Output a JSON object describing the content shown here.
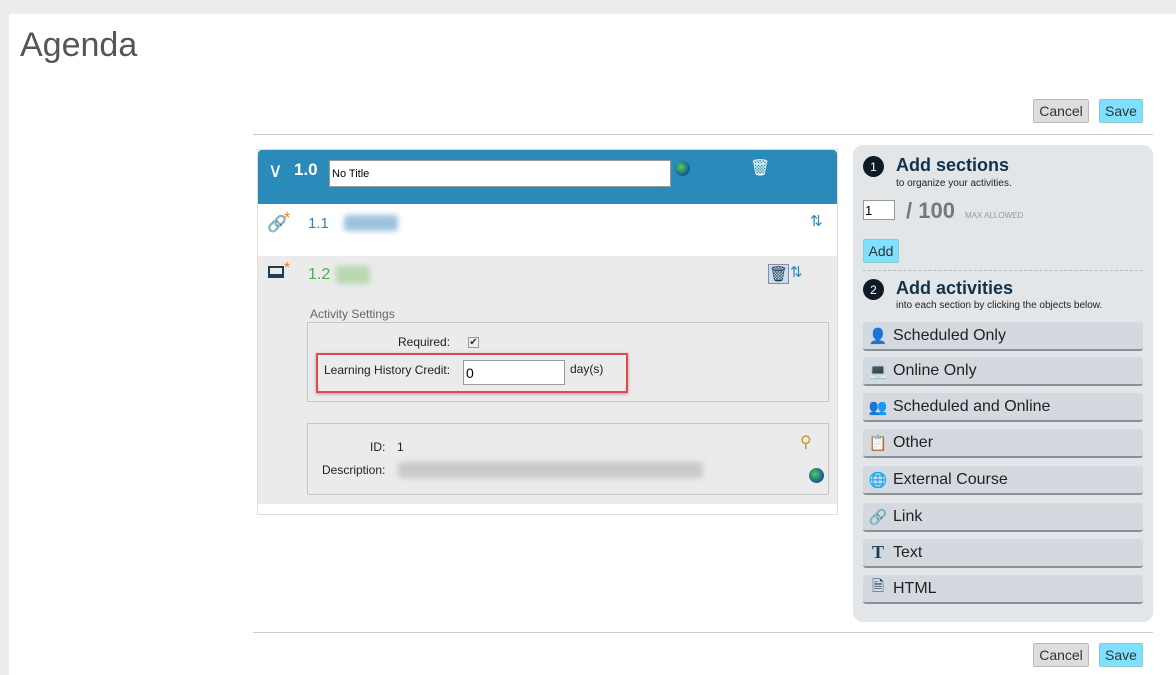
{
  "page": {
    "title": "Agenda"
  },
  "toolbar": {
    "cancel_label": "Cancel",
    "save_label": "Save"
  },
  "section": {
    "number": "1.0",
    "title_value": "No Title",
    "activities": [
      {
        "number": "1.1",
        "type": "link"
      },
      {
        "number": "1.2",
        "type": "online",
        "settings": {
          "heading": "Activity Settings",
          "required_label": "Required:",
          "required_checked": true,
          "credit_label": "Learning History Credit:",
          "credit_value": "0",
          "credit_unit": "day(s)"
        },
        "details": {
          "id_label": "ID:",
          "id_value": "1",
          "description_label": "Description:"
        }
      }
    ]
  },
  "sidebar": {
    "step1": {
      "num": "1",
      "title": "Add sections",
      "subtitle": "to organize your activities.",
      "count_value": "1",
      "max": "/ 100",
      "max_label": "MAX ALLOWED",
      "add_label": "Add"
    },
    "step2": {
      "num": "2",
      "title": "Add activities",
      "subtitle": "into each section by clicking the objects below."
    },
    "items": [
      {
        "label": "Scheduled Only",
        "icon": "person-icon"
      },
      {
        "label": "Online Only",
        "icon": "laptop-icon"
      },
      {
        "label": "Scheduled and Online",
        "icon": "person-laptop-icon"
      },
      {
        "label": "Other",
        "icon": "clipboard-icon"
      },
      {
        "label": "External Course",
        "icon": "globe-icon"
      },
      {
        "label": "Link",
        "icon": "link-icon"
      },
      {
        "label": "Text",
        "icon": "text-icon"
      },
      {
        "label": "HTML",
        "icon": "html-file-icon"
      }
    ]
  },
  "colors": {
    "header": "#2a8bbb",
    "accent_button": "#7fe0ff",
    "highlight": "#e8474a",
    "online_green": "#4cae4c",
    "star": "#f07f1d"
  }
}
